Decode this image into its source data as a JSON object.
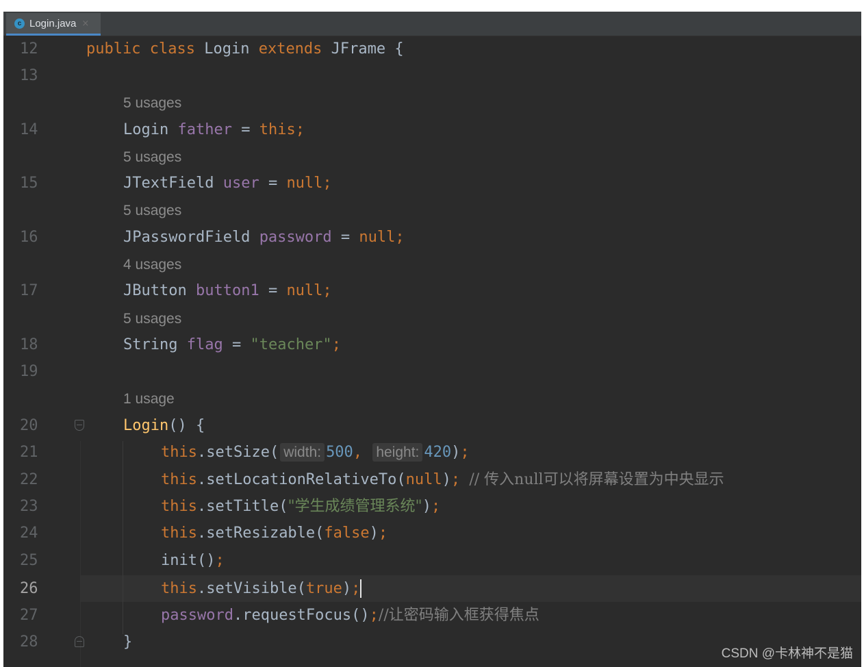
{
  "tab": {
    "icon": "class-c-icon",
    "icon_glyph": "c",
    "label": "Login.java",
    "close": "×"
  },
  "lines": {
    "l12": "12",
    "l13": "13",
    "l14": "14",
    "l15": "15",
    "l16": "16",
    "l17": "17",
    "l18": "18",
    "l19": "19",
    "l20": "20",
    "l21": "21",
    "l22": "22",
    "l23": "23",
    "l24": "24",
    "l25": "25",
    "l26": "26",
    "l27": "27",
    "l28": "28"
  },
  "usages": {
    "father": "5 usages",
    "user": "5 usages",
    "password": "5 usages",
    "button1": "4 usages",
    "flag": "5 usages",
    "ctor": "1 usage"
  },
  "code": {
    "l12": {
      "public": "public",
      "class": "class",
      "name": "Login",
      "extends": "extends",
      "super": "JFrame",
      "brace": "{"
    },
    "l14": {
      "type": "Login",
      "field": "father",
      "eq": "=",
      "this": "this",
      "semi": ";"
    },
    "l15": {
      "type": "JTextField",
      "field": "user",
      "eq": "=",
      "null": "null",
      "semi": ";"
    },
    "l16": {
      "type": "JPasswordField",
      "field": "password",
      "eq": "=",
      "null": "null",
      "semi": ";"
    },
    "l17": {
      "type": "JButton",
      "field": "button1",
      "eq": "=",
      "null": "null",
      "semi": ";"
    },
    "l18": {
      "type": "String",
      "field": "flag",
      "eq": "=",
      "value": "\"teacher\"",
      "semi": ";"
    },
    "l20": {
      "name": "Login",
      "rest": "() {"
    },
    "l21": {
      "this": "this",
      "call": ".setSize(",
      "hint_width": "width:",
      "width": "500",
      "comma": ",",
      "hint_height": "height:",
      "height": "420",
      "close": ")",
      "semi": ";"
    },
    "l22": {
      "this": "this",
      "call": ".setLocationRelativeTo(",
      "null": "null",
      "close": ")",
      "semi": ";",
      "comment": "// 传入null可以将屏幕设置为中央显示"
    },
    "l23": {
      "this": "this",
      "call": ".setTitle(",
      "value": "\"学生成绩管理系统\"",
      "close": ")",
      "semi": ";"
    },
    "l24": {
      "this": "this",
      "call": ".setResizable(",
      "arg": "false",
      "close": ")",
      "semi": ";"
    },
    "l25": {
      "call": "init()",
      "semi": ";"
    },
    "l26": {
      "this": "this",
      "call": ".setVisible(",
      "arg": "true",
      "close": ")",
      "semi": ";"
    },
    "l27": {
      "field": "password",
      "call": ".requestFocus()",
      "semi": ";",
      "comment": "//让密码输入框获得焦点"
    },
    "l28": {
      "brace": "}"
    }
  },
  "watermark": "CSDN @卡林神不是猫",
  "colors": {
    "background": "#2b2b2b",
    "keyword": "#cc7832",
    "identifier": "#a9b7c6",
    "field": "#9876aa",
    "method": "#ffc66d",
    "number": "#6897bb",
    "string": "#6a8759",
    "comment": "#808080"
  }
}
